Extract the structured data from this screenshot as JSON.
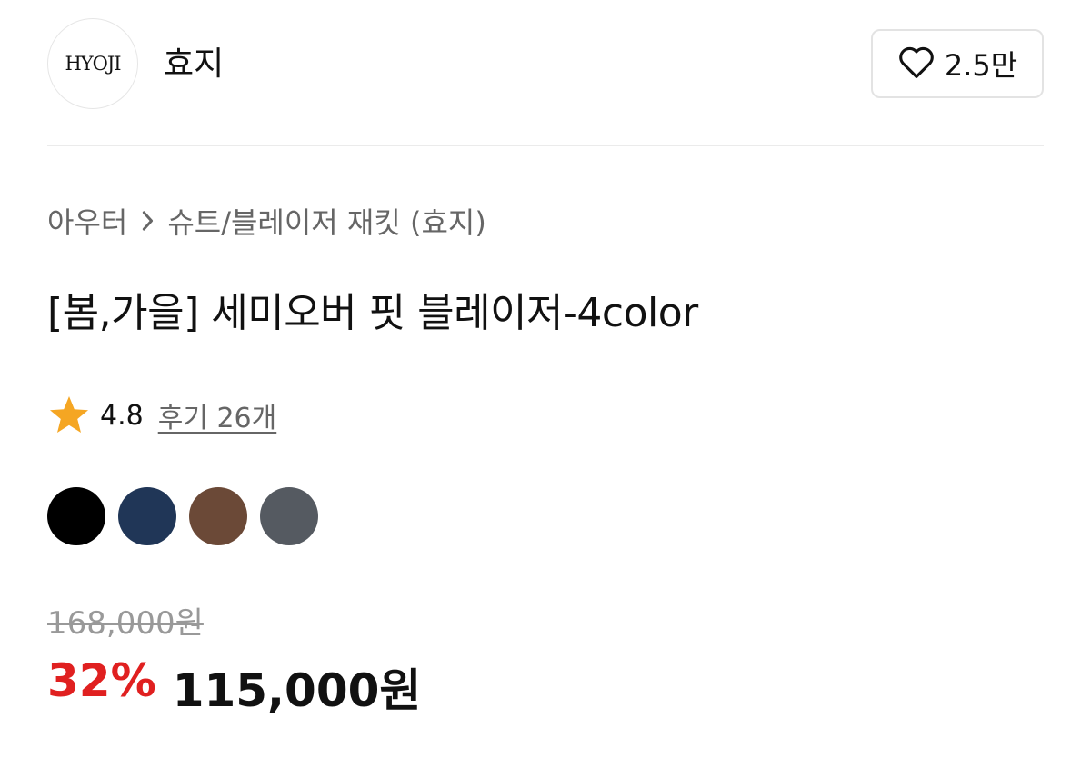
{
  "brand": {
    "logo_text": "HYOJI",
    "name": "효지",
    "like_count": "2.5만"
  },
  "breadcrumb": {
    "category": "아우터",
    "subcategory": "슈트/블레이저 재킷 (효지)"
  },
  "product": {
    "title": "[봄,가을] 세미오버 핏 블레이저-4color",
    "rating": "4.8",
    "review_label": "후기 26개"
  },
  "colors": {
    "swatches": [
      "#000000",
      "#203657",
      "#6b4937",
      "#555a61"
    ],
    "star": "#f5a623",
    "discount": "#e02020"
  },
  "price": {
    "original": "168,000원",
    "discount_rate": "32%",
    "sale": "115,000원"
  }
}
